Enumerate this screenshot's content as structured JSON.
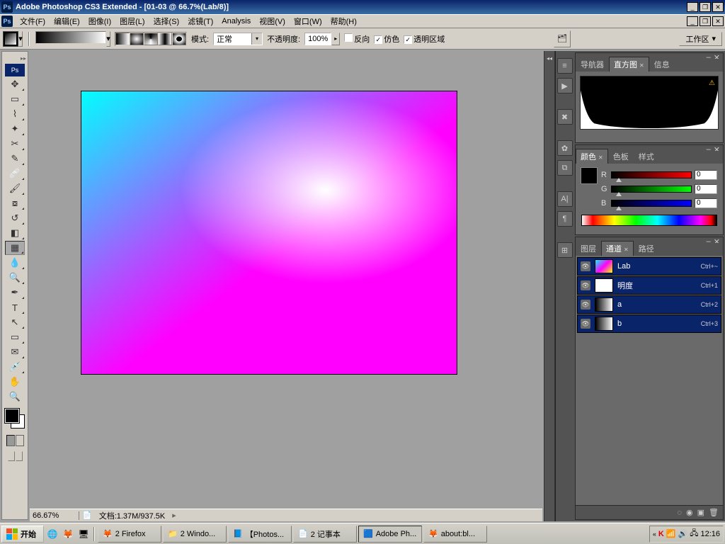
{
  "titlebar": {
    "app": "Adobe Photoshop CS3 Extended",
    "doc": "[01-03 @ 66.7%(Lab/8)]"
  },
  "menu": {
    "file": "文件(F)",
    "edit": "编辑(E)",
    "image": "图像(I)",
    "layer": "图层(L)",
    "select": "选择(S)",
    "filter": "滤镜(T)",
    "analysis": "Analysis",
    "view": "视图(V)",
    "window": "窗口(W)",
    "help": "帮助(H)"
  },
  "options": {
    "mode_label": "模式:",
    "mode_value": "正常",
    "opacity_label": "不透明度:",
    "opacity_value": "100%",
    "reverse": "反向",
    "dither": "仿色",
    "transparency": "透明区域",
    "workspace": "工作区"
  },
  "status": {
    "zoom": "66.67%",
    "docinfo": "文档:1.37M/937.5K"
  },
  "panels": {
    "nav_tabs": [
      "导航器",
      "直方图",
      "信息"
    ],
    "color_tabs": [
      "颜色",
      "色板",
      "样式"
    ],
    "layer_tabs": [
      "图层",
      "通道",
      "路径"
    ]
  },
  "color": {
    "r": "0",
    "g": "0",
    "b": "0",
    "labels": {
      "r": "R",
      "g": "G",
      "b": "B"
    }
  },
  "channels": [
    {
      "name": "Lab",
      "key": "Ctrl+~",
      "thumb": "lab"
    },
    {
      "name": "明度",
      "key": "Ctrl+1",
      "thumb": "lum"
    },
    {
      "name": "a",
      "key": "Ctrl+2",
      "thumb": "a"
    },
    {
      "name": "b",
      "key": "Ctrl+3",
      "thumb": "b"
    }
  ],
  "taskbar": {
    "start": "开始",
    "tasks": [
      {
        "label": "2 Firefox",
        "icon": "🦊"
      },
      {
        "label": "2 Windo...",
        "icon": "📁"
      },
      {
        "label": "【Photos...",
        "icon": "📘"
      },
      {
        "label": "2 记事本",
        "icon": "📄"
      },
      {
        "label": "Adobe Ph...",
        "icon": "🟦",
        "active": true
      },
      {
        "label": "about:bl...",
        "icon": "🦊"
      }
    ],
    "clock": "12:16"
  }
}
